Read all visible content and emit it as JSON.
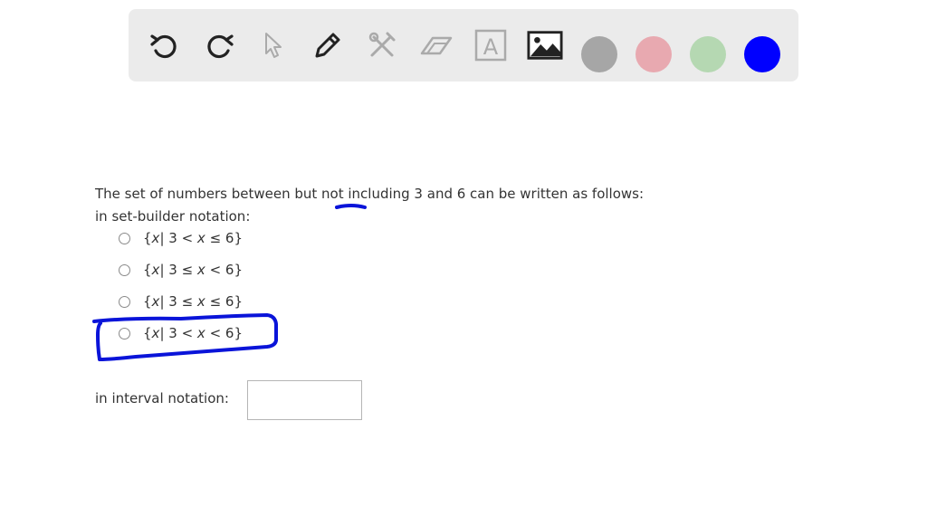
{
  "toolbar": {
    "tools": [
      {
        "name": "undo-icon"
      },
      {
        "name": "redo-icon"
      },
      {
        "name": "pointer-icon"
      },
      {
        "name": "pen-icon"
      },
      {
        "name": "tools-icon"
      },
      {
        "name": "eraser-icon"
      },
      {
        "name": "text-icon",
        "glyph": "A"
      },
      {
        "name": "image-icon"
      }
    ],
    "colors": [
      "#a6a6a6",
      "#e8a9b0",
      "#b5d8b2",
      "#0000ff"
    ]
  },
  "question": {
    "line1": "The set of numbers between but not including 3 and 6 can be written as follows:",
    "line2": "in set-builder notation:",
    "options": [
      {
        "pre": "{",
        "var1": "x",
        "mid": "| 3 < ",
        "var2": "x",
        "post": " ≤ 6}"
      },
      {
        "pre": "{",
        "var1": "x",
        "mid": "| 3 ≤ ",
        "var2": "x",
        "post": " < 6}"
      },
      {
        "pre": "{",
        "var1": "x",
        "mid": "| 3 ≤ ",
        "var2": "x",
        "post": " ≤ 6}"
      },
      {
        "pre": "{",
        "var1": "x",
        "mid": "| 3 < ",
        "var2": "x",
        "post": " < 6}"
      }
    ],
    "interval_label": "in interval notation:",
    "interval_value": ""
  },
  "annotation": {
    "pen_color": "#0a14d9"
  }
}
